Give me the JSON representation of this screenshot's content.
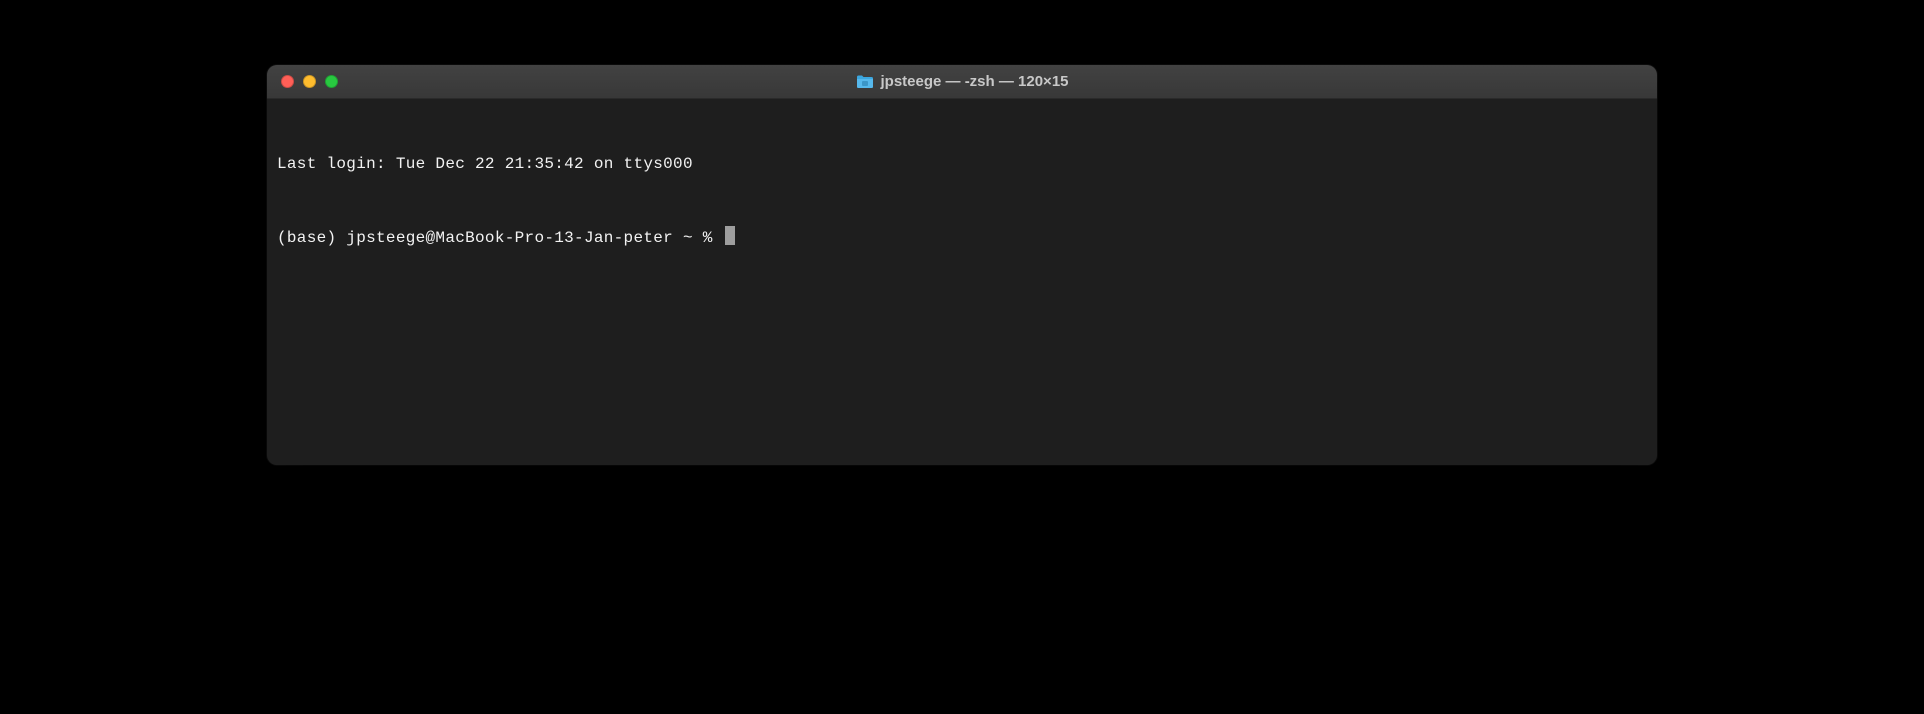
{
  "window": {
    "title": "jpsteege — -zsh — 120×15"
  },
  "terminal": {
    "last_login_line": "Last login: Tue Dec 22 21:35:42 on ttys000",
    "prompt": "(base) jpsteege@MacBook-Pro-13-Jan-peter ~ % "
  }
}
